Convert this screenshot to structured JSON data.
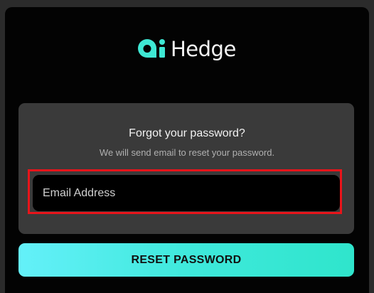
{
  "brand": {
    "name": "Hedge",
    "logo_icon": "ai-logo-icon",
    "accent_color": "#3ee8d4"
  },
  "reset_form": {
    "title": "Forgot your password?",
    "subtitle": "We will send email to reset your password.",
    "email_input": {
      "placeholder": "Email Address",
      "value": ""
    },
    "submit_label": "RESET PASSWORD",
    "highlight_color": "#e8141a"
  }
}
